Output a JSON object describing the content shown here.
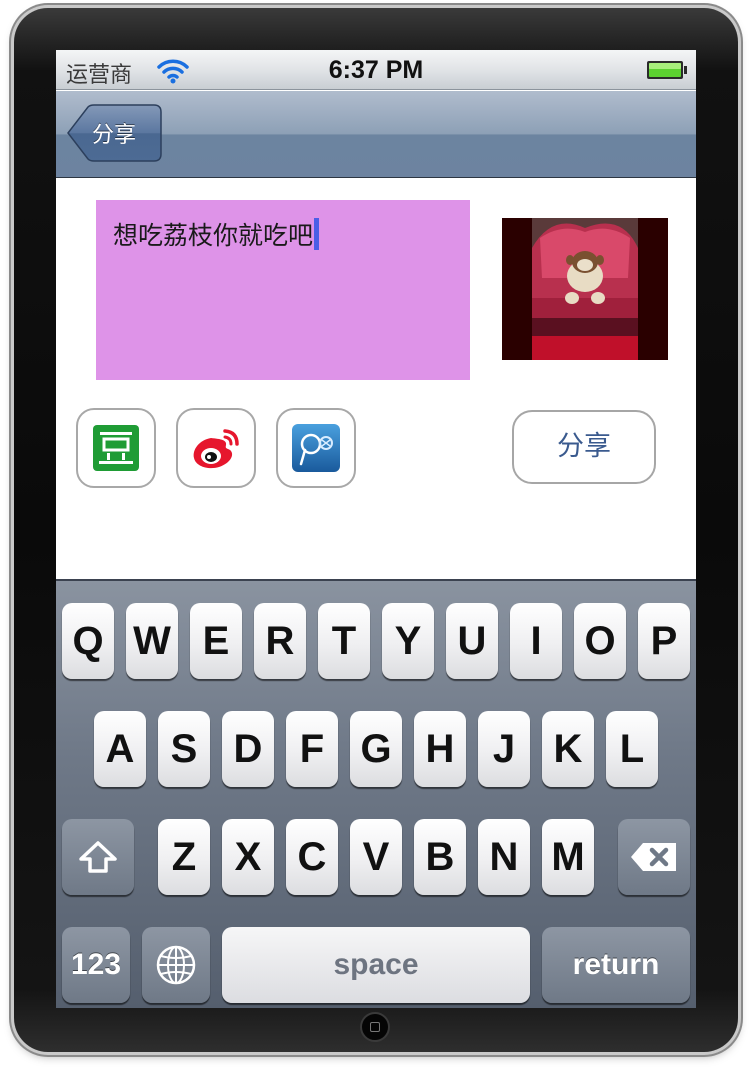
{
  "status_bar": {
    "carrier": "运营商",
    "time": "6:37 PM"
  },
  "nav_bar": {
    "back_label": "分享"
  },
  "compose": {
    "text_value": "想吃荔枝你就吃吧",
    "share_targets": [
      {
        "name": "douban",
        "glyph": "豆"
      },
      {
        "name": "sina-weibo",
        "glyph": ""
      },
      {
        "name": "tencent-weibo",
        "glyph": ""
      }
    ],
    "share_button_label": "分享"
  },
  "keyboard": {
    "row1": [
      "Q",
      "W",
      "E",
      "R",
      "T",
      "Y",
      "U",
      "I",
      "O",
      "P"
    ],
    "row2": [
      "A",
      "S",
      "D",
      "F",
      "G",
      "H",
      "J",
      "K",
      "L"
    ],
    "row3": [
      "Z",
      "X",
      "C",
      "V",
      "B",
      "N",
      "M"
    ],
    "numbers_label": "123",
    "space_label": "space",
    "return_label": "return"
  },
  "colors": {
    "text_box_bg": "#de93e8",
    "cursor": "#4b5ee6",
    "nav_bar": "#8da0b6",
    "share_label": "#3a5a8e"
  }
}
